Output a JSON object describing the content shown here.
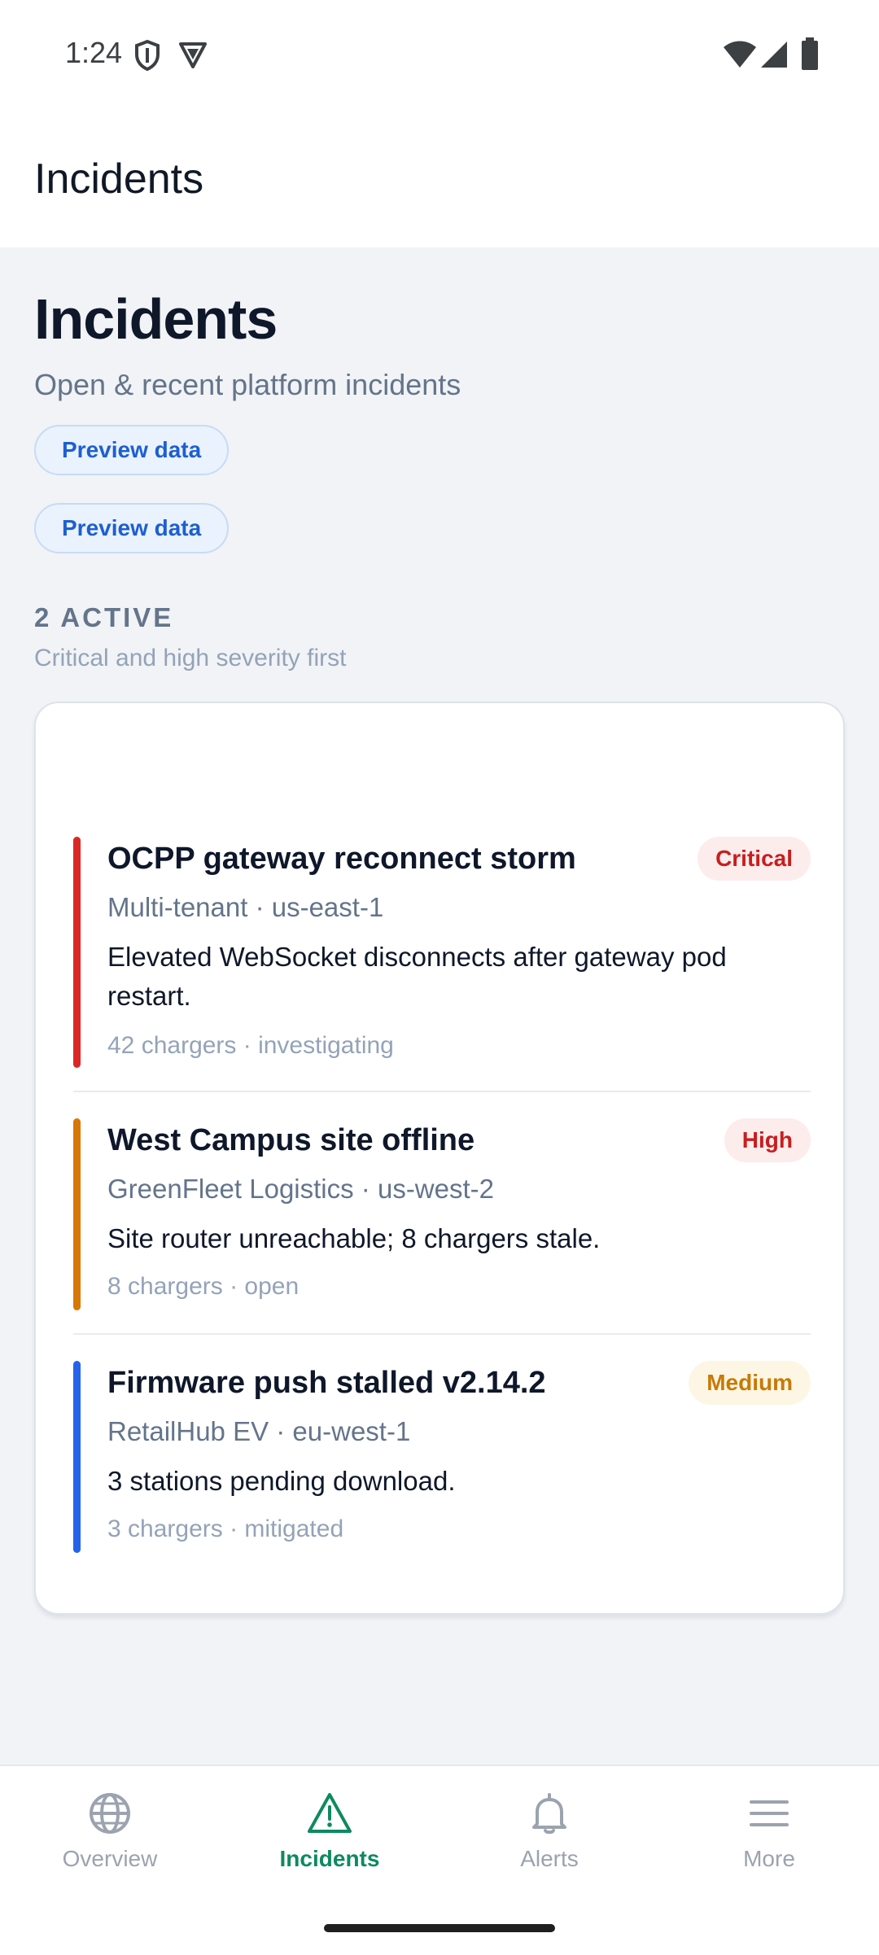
{
  "status_bar": {
    "time": "1:24",
    "icons": [
      "shield-icon",
      "vpn-icon",
      "wifi-icon",
      "signal-icon",
      "battery-icon"
    ]
  },
  "app_bar": {
    "title": "Incidents"
  },
  "header": {
    "title": "Incidents",
    "subtitle": "Open & recent platform incidents",
    "chips": [
      "Preview data",
      "Preview data"
    ]
  },
  "section": {
    "label": "2 ACTIVE",
    "sub": "Critical and high severity first"
  },
  "incidents": [
    {
      "title": "OCPP gateway reconnect storm",
      "severity": "Critical",
      "meta": "Multi-tenant · us-east-1",
      "description": "Elevated WebSocket disconnects after gateway pod restart.",
      "footer": "42 chargers · investigating",
      "bar_color": "#dc2626",
      "badge_bg": "#fdecec",
      "badge_fg": "#c81e1e"
    },
    {
      "title": "West Campus site offline",
      "severity": "High",
      "meta": "GreenFleet Logistics · us-west-2",
      "description": "Site router unreachable; 8 chargers stale.",
      "footer": "8 chargers · open",
      "bar_color": "#d97706",
      "badge_bg": "#fdecec",
      "badge_fg": "#c81e1e"
    },
    {
      "title": "Firmware push stalled v2.14.2",
      "severity": "Medium",
      "meta": "RetailHub EV · eu-west-1",
      "description": "3 stations pending download.",
      "footer": "3 chargers · mitigated",
      "bar_color": "#2563eb",
      "badge_bg": "#fef6e4",
      "badge_fg": "#c77a05"
    }
  ],
  "bottom_nav": {
    "items": [
      {
        "label": "Overview",
        "icon": "globe-icon",
        "active": false
      },
      {
        "label": "Incidents",
        "icon": "warning-icon",
        "active": true
      },
      {
        "label": "Alerts",
        "icon": "bell-icon",
        "active": false
      },
      {
        "label": "More",
        "icon": "menu-icon",
        "active": false
      }
    ]
  },
  "colors": {
    "accent": "#0e8a5f",
    "chip_text": "#1d5fd1",
    "page_bg": "#f1f3f6"
  }
}
